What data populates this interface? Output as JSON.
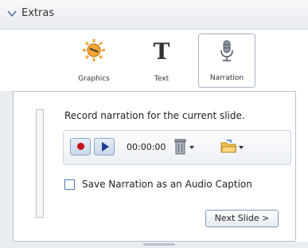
{
  "panel": {
    "title": "Extras"
  },
  "tools": [
    {
      "label": "Graphics",
      "icon": "graphics-sun-icon",
      "selected": false
    },
    {
      "label": "Text",
      "icon": "text-t-icon",
      "selected": false
    },
    {
      "label": "Narration",
      "icon": "microphone-icon",
      "selected": true
    }
  ],
  "narration": {
    "instruction": "Record narration for the current slide.",
    "timer": "00:00:00",
    "save_caption_label": "Save Narration as an Audio Caption",
    "save_caption_checked": false,
    "next_button_label": "Next Slide >",
    "level_fraction": 0.0
  },
  "colors": {
    "accent_border": "#a6b3c6",
    "record_red": "#c7121a",
    "play_blue": "#1c3f8a",
    "folder_yellow": "#f2c14e"
  }
}
